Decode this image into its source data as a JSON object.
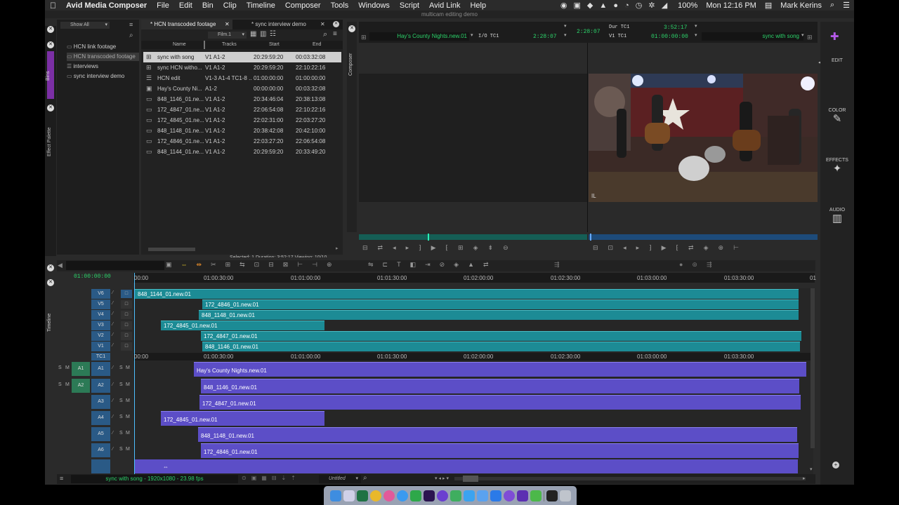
{
  "menubar": {
    "apple": "",
    "app": "Avid Media Composer",
    "items": [
      "File",
      "Edit",
      "Bin",
      "Clip",
      "Timeline",
      "Composer",
      "Tools",
      "Windows",
      "Script",
      "Avid Link",
      "Help"
    ],
    "battery": "100%",
    "datetime": "Mon 12:16 PM",
    "user": "Mark Kerins"
  },
  "window_title": "multicam editing demo",
  "bins_panel": {
    "show_label": "Show All",
    "tab_label": "Bins",
    "items": [
      "HCN link footage",
      "HCN transcoded footage",
      "interviews",
      "sync interview demo"
    ]
  },
  "effect_palette_label": "Effect Palette",
  "bin": {
    "tabs": [
      "* HCN transcoded footage",
      "* sync interview demo"
    ],
    "view": "Film.1",
    "columns": [
      "Name",
      "Tracks",
      "Start",
      "End"
    ],
    "rows": [
      {
        "name": "sync with song",
        "tracks": "V1 A1-2",
        "start": "20:29:59:20",
        "end": "00:03:32:08",
        "icon": "multigroup-icon"
      },
      {
        "name": "sync HCN witho...",
        "tracks": "V1 A1-2",
        "start": "20:29:59:20",
        "end": "22:10:22:16",
        "icon": "multigroup-icon"
      },
      {
        "name": "HCN edit",
        "tracks": "V1-3 A1-4 TC1-8 ...",
        "start": "01:00:00:00",
        "end": "01:00:00:00",
        "icon": "sequence-icon"
      },
      {
        "name": "Hay's County Ni...",
        "tracks": "A1-2",
        "start": "00:00:00:00",
        "end": "00:03:32:08",
        "icon": "subclip-icon"
      },
      {
        "name": "848_1146_01.ne...",
        "tracks": "V1 A1-2",
        "start": "20:34:46:04",
        "end": "20:38:13:08",
        "icon": "clip-icon"
      },
      {
        "name": "172_4847_01.ne...",
        "tracks": "V1 A1-2",
        "start": "22:06:54:08",
        "end": "22:10:22:16",
        "icon": "clip-icon"
      },
      {
        "name": "172_4845_01.ne...",
        "tracks": "V1 A1-2",
        "start": "22:02:31:00",
        "end": "22:03:27:20",
        "icon": "clip-icon"
      },
      {
        "name": "848_1148_01.ne...",
        "tracks": "V1 A1-2",
        "start": "20:38:42:08",
        "end": "20:42:10:00",
        "icon": "clip-icon"
      },
      {
        "name": "172_4846_01.ne...",
        "tracks": "V1 A1-2",
        "start": "22:03:27:20",
        "end": "22:06:54:08",
        "icon": "clip-icon"
      },
      {
        "name": "848_1144_01.ne...",
        "tracks": "V1 A1-2",
        "start": "20:29:59:20",
        "end": "20:33:49:20",
        "icon": "clip-icon"
      }
    ],
    "status": "Selected: 1  Duration: 3:52:17   Viewing: 10/10"
  },
  "composer": {
    "label": "Composer",
    "source_name": "Hay's County Nights.new.01",
    "io_label": "I/O TC1",
    "io_value": "2:28:07",
    "center_tc": "2:28:07",
    "dur_label": "Dur TC1",
    "dur_value": "3:52:17",
    "v1_label": "V1 TC1",
    "v1_value": "01:00:00:00",
    "record_name": "sync with song",
    "overlay": "IL"
  },
  "right_tools": [
    {
      "label": "EDIT",
      "icon": "edit-icon"
    },
    {
      "label": "COLOR",
      "icon": "color-icon"
    },
    {
      "label": "EFFECTS",
      "icon": "effects-icon"
    },
    {
      "label": "AUDIO",
      "icon": "audio-icon"
    }
  ],
  "timeline": {
    "label": "Timeline",
    "timecode": "01:00:00:00",
    "ruler": [
      "00:00",
      "01:00:30:00",
      "01:01:00:00",
      "01:01:30:00",
      "01:02:00:00",
      "01:02:30:00",
      "01:03:00:00",
      "01:03:30:00",
      "01"
    ],
    "ruler2": [
      "00:00",
      "01:00:30:00",
      "01:01:00:00",
      "01:01:30:00",
      "01:02:00:00",
      "01:02:30:00",
      "01:03:00:00",
      "01:03:30:00"
    ],
    "video_tracks": [
      {
        "label": "V6",
        "clip": "848_1144_01.new.01"
      },
      {
        "label": "V5",
        "clip": "172_4846_01.new.01"
      },
      {
        "label": "V4",
        "clip": "848_1148_01.new.01"
      },
      {
        "label": "V3",
        "clip": "172_4845_01.new.01"
      },
      {
        "label": "V2",
        "clip": "172_4847_01.new.01"
      },
      {
        "label": "V1",
        "clip": "848_1146_01.new.01"
      }
    ],
    "tc_label": "TC1",
    "audio_tracks": [
      {
        "label": "A1",
        "src": "A1",
        "clip": "Hay's County Nights.new.01"
      },
      {
        "label": "A2",
        "src": "A2",
        "clip": "848_1146_01.new.01"
      },
      {
        "label": "A3",
        "clip": "172_4847_01.new.01"
      },
      {
        "label": "A4",
        "clip": "172_4845_01.new.01"
      },
      {
        "label": "A5",
        "clip": "848_1148_01.new.01"
      },
      {
        "label": "A6",
        "clip": "172_4846_01.new.01"
      }
    ],
    "solo": "S",
    "mute": "M",
    "status": "sync with song - 1920x1080 - 23.98 fps",
    "untitled": "Untitled"
  }
}
